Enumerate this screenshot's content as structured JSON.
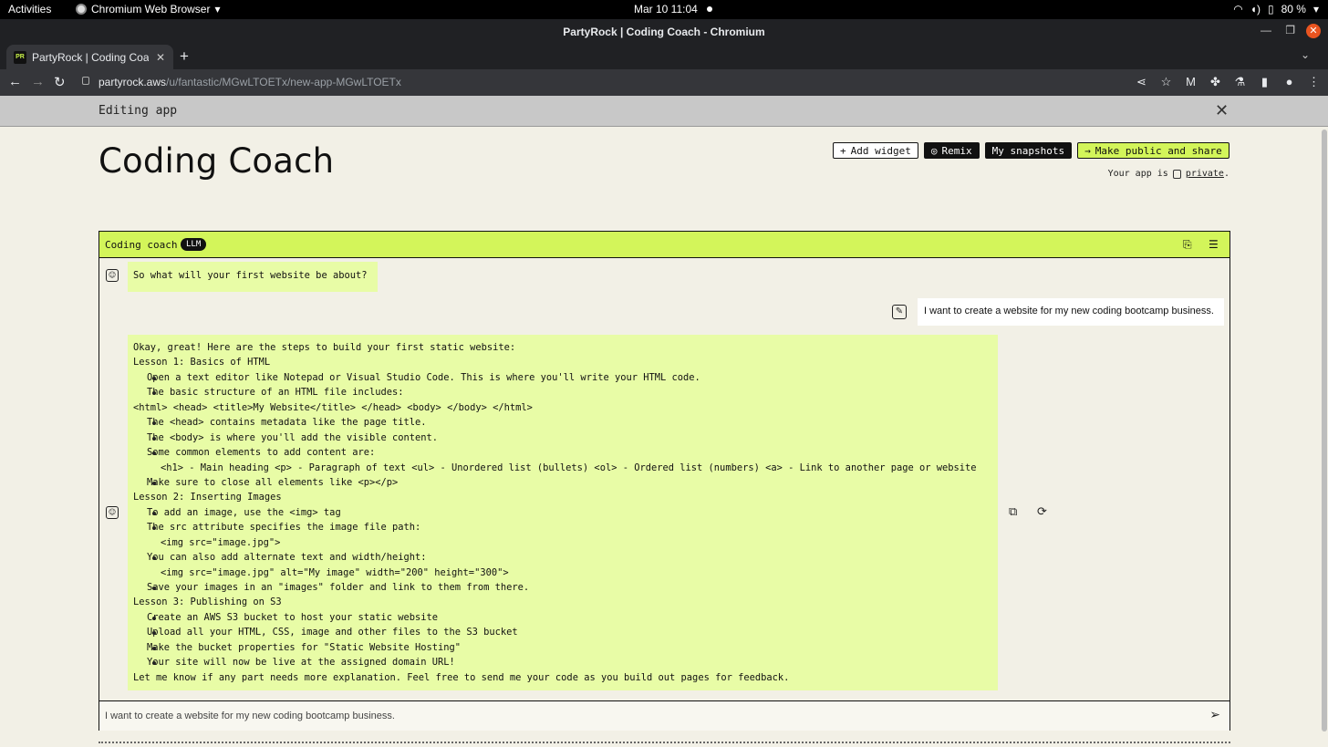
{
  "os": {
    "activities": "Activities",
    "app_name": "Chromium Web Browser",
    "clock": "Mar 10  11:04",
    "battery": "80 %"
  },
  "browser": {
    "window_title": "PartyRock | Coding Coach - Chromium",
    "tab_title": "PartyRock | Coding Coach",
    "favicon_text": "PR",
    "url_domain": "partyrock.aws",
    "url_path": "/u/fantastic/MGwLTOETx/new-app-MGwLTOETx"
  },
  "editbar": {
    "label": "Editing app"
  },
  "app": {
    "title": "Coding Coach",
    "buttons": {
      "add_widget": "Add widget",
      "remix": "Remix",
      "snapshots": "My snapshots",
      "make_public": "Make public and share"
    },
    "privacy_prefix": "Your app is",
    "privacy_value": "private",
    "privacy_suffix": "."
  },
  "widget": {
    "title": "Coding coach",
    "badge": "LLM",
    "bot_msg_1": "So what will your first website be about?",
    "user_msg": "I want to create a website for my new coding bootcamp business.",
    "bot_msg_2": [
      {
        "kind": "p",
        "text": "Okay, great! Here are the steps to build your first static website:"
      },
      {
        "kind": "p",
        "text": "Lesson 1: Basics of HTML"
      },
      {
        "kind": "b",
        "text": "Open a text editor like Notepad or Visual Studio Code. This is where you'll write your HTML code."
      },
      {
        "kind": "b",
        "text": "The basic structure of an HTML file includes:"
      },
      {
        "kind": "p",
        "text": "<html> <head> <title>My Website</title> </head> <body> </body> </html>"
      },
      {
        "kind": "b",
        "text": "The <head> contains metadata like the page title."
      },
      {
        "kind": "b",
        "text": "The <body> is where you'll add the visible content."
      },
      {
        "kind": "b",
        "text": "Some common elements to add content are:"
      },
      {
        "kind": "i",
        "text": "<h1> - Main heading <p> - Paragraph of text <ul> - Unordered list (bullets) <ol> - Ordered list (numbers) <a> - Link to another page or website"
      },
      {
        "kind": "b",
        "text": "Make sure to close all elements like <p></p>"
      },
      {
        "kind": "p",
        "text": "Lesson 2: Inserting Images"
      },
      {
        "kind": "b",
        "text": "To add an image, use the <img> tag"
      },
      {
        "kind": "b",
        "text": "The src attribute specifies the image file path:"
      },
      {
        "kind": "i",
        "text": "<img src=\"image.jpg\">"
      },
      {
        "kind": "b",
        "text": "You can also add alternate text and width/height:"
      },
      {
        "kind": "i",
        "text": "<img src=\"image.jpg\" alt=\"My image\" width=\"200\" height=\"300\">"
      },
      {
        "kind": "b",
        "text": "Save your images in an \"images\" folder and link to them from there."
      },
      {
        "kind": "p",
        "text": "Lesson 3: Publishing on S3"
      },
      {
        "kind": "b",
        "text": "Create an AWS S3 bucket to host your static website"
      },
      {
        "kind": "b",
        "text": "Upload all your HTML, CSS, image and other files to the S3 bucket"
      },
      {
        "kind": "b",
        "text": "Make the bucket properties for \"Static Website Hosting\""
      },
      {
        "kind": "b",
        "text": "Your site will now be live at the assigned domain URL!"
      },
      {
        "kind": "p",
        "text": "Let me know if any part needs more explanation. Feel free to send me your code as you build out pages for feedback."
      }
    ],
    "input_value": "I want to create a website for my new coding bootcamp business."
  },
  "colors": {
    "accent_lime": "#d3f55a",
    "bubble_lime": "#e8fca6",
    "background": "#f2f0e6"
  }
}
